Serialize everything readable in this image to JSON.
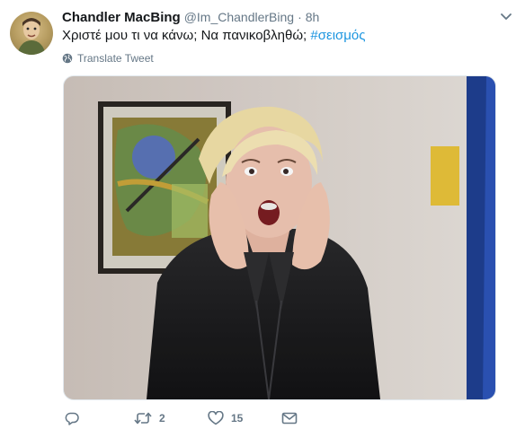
{
  "tweet": {
    "display_name": "Chandler MacBing",
    "handle": "@Im_ChandlerBing",
    "separator": "·",
    "time": "8h",
    "text": "Χριστέ μου τι να κάνω; Να πανικοβληθώ; ",
    "hashtag": "#σεισμός",
    "translate_label": "Translate Tweet",
    "retweet_count": "2",
    "like_count": "15"
  },
  "icons": {
    "caret": "chevron-down-icon",
    "globe": "globe-icon",
    "reply": "reply-icon",
    "retweet": "retweet-icon",
    "like": "heart-icon",
    "dm": "envelope-icon"
  },
  "colors": {
    "text": "#14171a",
    "muted": "#657786",
    "link": "#1b95e0"
  }
}
